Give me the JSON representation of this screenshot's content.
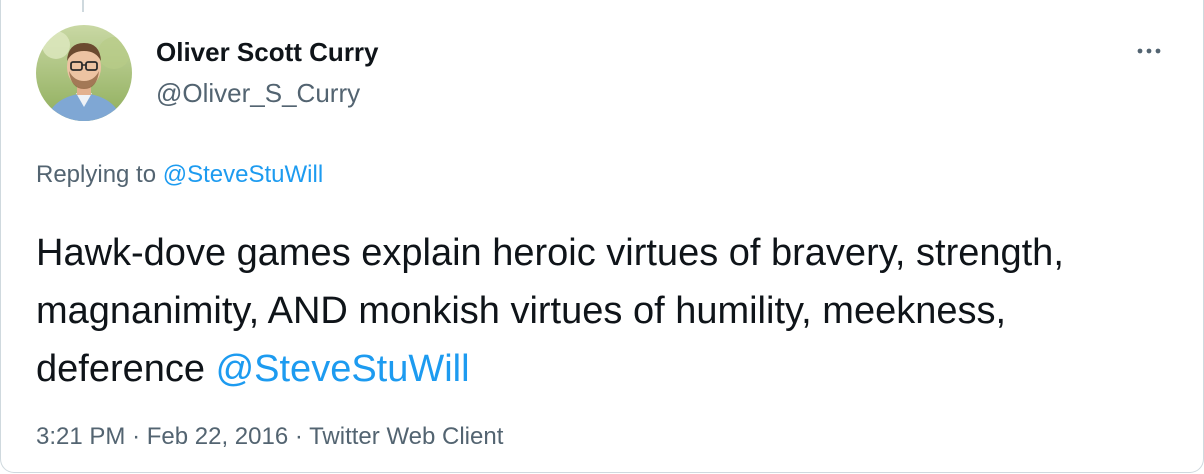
{
  "author": {
    "name": "Oliver Scott Curry",
    "handle": "@Oliver_S_Curry",
    "avatar_icon": "user-avatar-photo"
  },
  "more_icon": "more-options-icon",
  "reply": {
    "prefix": "Replying to",
    "mention": "@SteveStuWill"
  },
  "tweet": {
    "text": "Hawk-dove games explain heroic virtues of bravery, strength, magnanimity, AND monkish virtues of humility, meekness, deference",
    "mention": "@SteveStuWill"
  },
  "meta": {
    "time": "3:21 PM",
    "separator": "·",
    "date": "Feb 22, 2016",
    "client": "Twitter Web Client"
  },
  "colors": {
    "accent": "#1d9bf0",
    "text": "#0f1419",
    "secondary": "#536471",
    "border": "#cfd9de"
  }
}
